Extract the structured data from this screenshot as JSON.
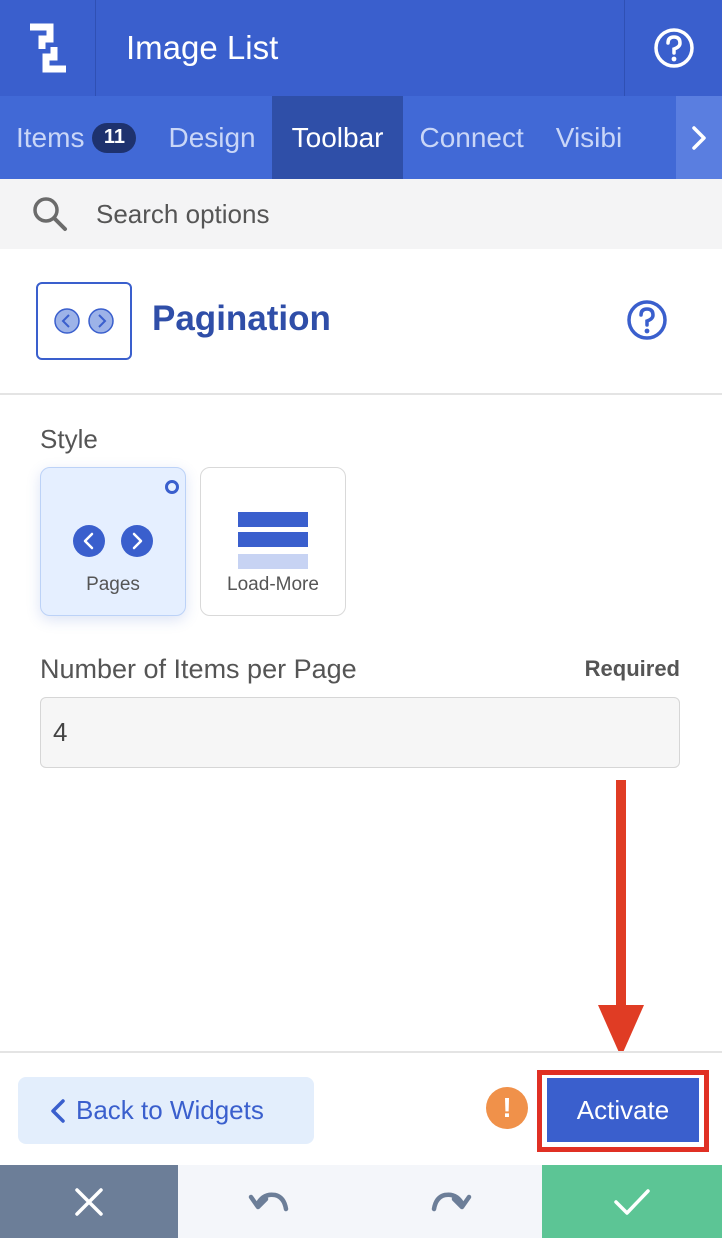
{
  "header": {
    "title": "Image List",
    "logo_icon": "logo-icon",
    "help_icon": "help-circle-icon"
  },
  "tabs": [
    {
      "label": "Items",
      "badge": "11"
    },
    {
      "label": "Design"
    },
    {
      "label": "Toolbar",
      "active": true
    },
    {
      "label": "Connect"
    },
    {
      "label": "Visibi"
    }
  ],
  "search": {
    "placeholder": "Search options"
  },
  "section": {
    "title": "Pagination"
  },
  "style": {
    "label": "Style",
    "options": [
      {
        "label": "Pages",
        "selected": true
      },
      {
        "label": "Load-More",
        "selected": false
      }
    ]
  },
  "items_per_page": {
    "label": "Number of Items per Page",
    "required": "Required",
    "value": "4"
  },
  "footer": {
    "back_label": "Back to Widgets",
    "warning_glyph": "!",
    "activate_label": "Activate"
  },
  "colors": {
    "primary": "#3a5fcd",
    "header_bg": "#3a5fcd",
    "tab_active_bg": "#2f4fa8",
    "warning": "#f0914a",
    "highlight": "#e03024",
    "confirm": "#5cc595",
    "cancel": "#6c7e98"
  }
}
